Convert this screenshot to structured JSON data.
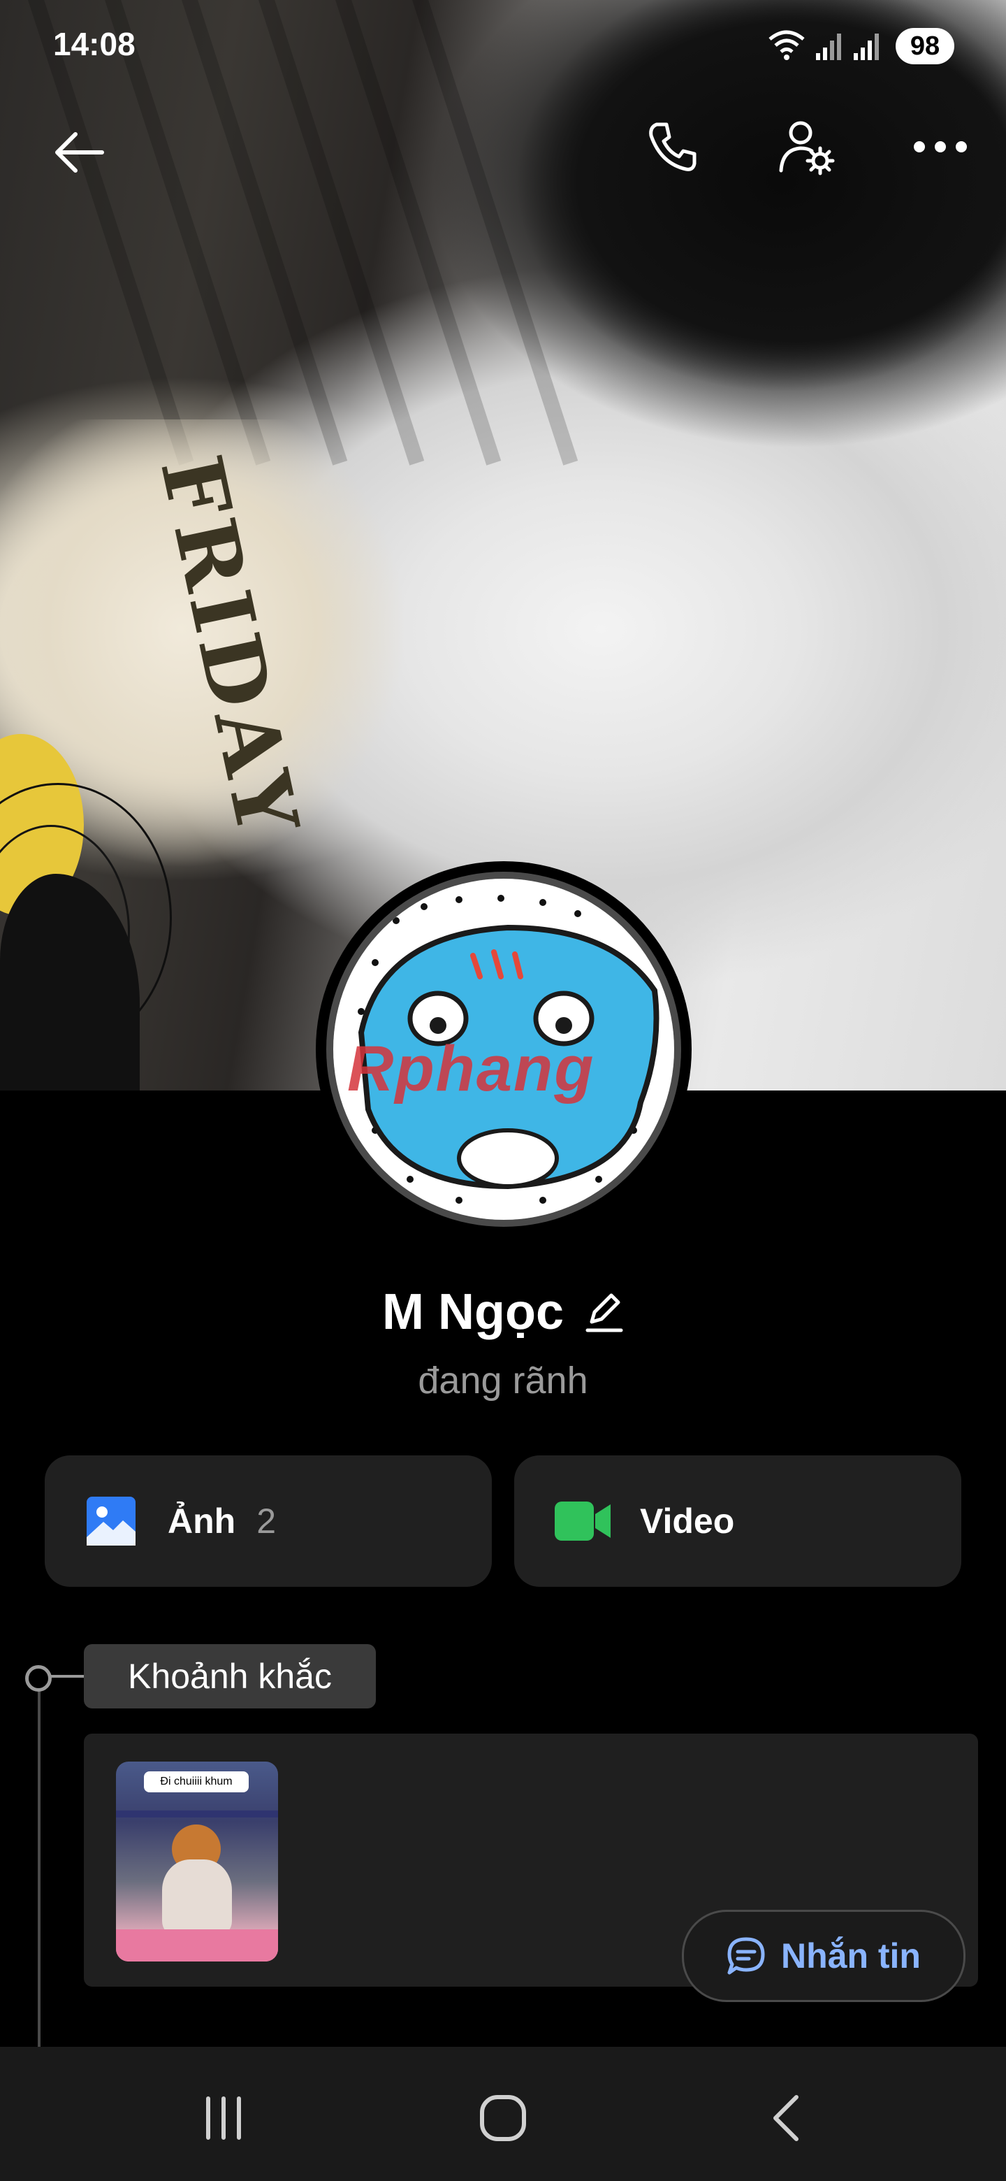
{
  "status_bar": {
    "time": "14:08",
    "battery": "98",
    "icons": [
      "wifi-icon",
      "signal-icon",
      "signal-icon"
    ]
  },
  "top_bar": {
    "icons": [
      "back-arrow-icon",
      "phone-icon",
      "user-settings-icon",
      "more-icon"
    ]
  },
  "profile": {
    "name": "M Ngọc",
    "status_text": "đang rãnh",
    "avatar_watermark": "Rphang"
  },
  "media_cards": [
    {
      "label": "Ảnh",
      "count": "2",
      "icon": "image-icon",
      "icon_color": "#2f7bf5"
    },
    {
      "label": "Video",
      "count": "",
      "icon": "video-camera-icon",
      "icon_color": "#30c25b"
    }
  ],
  "moments": {
    "title": "Khoảnh khắc",
    "thumbnail_caption": "Đi chuiiii khum"
  },
  "message_button": {
    "label": "Nhắn tin",
    "icon": "chat-bubble-icon",
    "color": "#8ab4ff"
  },
  "nav_bar": {
    "icons": [
      "recent-apps-icon",
      "home-icon",
      "back-icon"
    ]
  }
}
